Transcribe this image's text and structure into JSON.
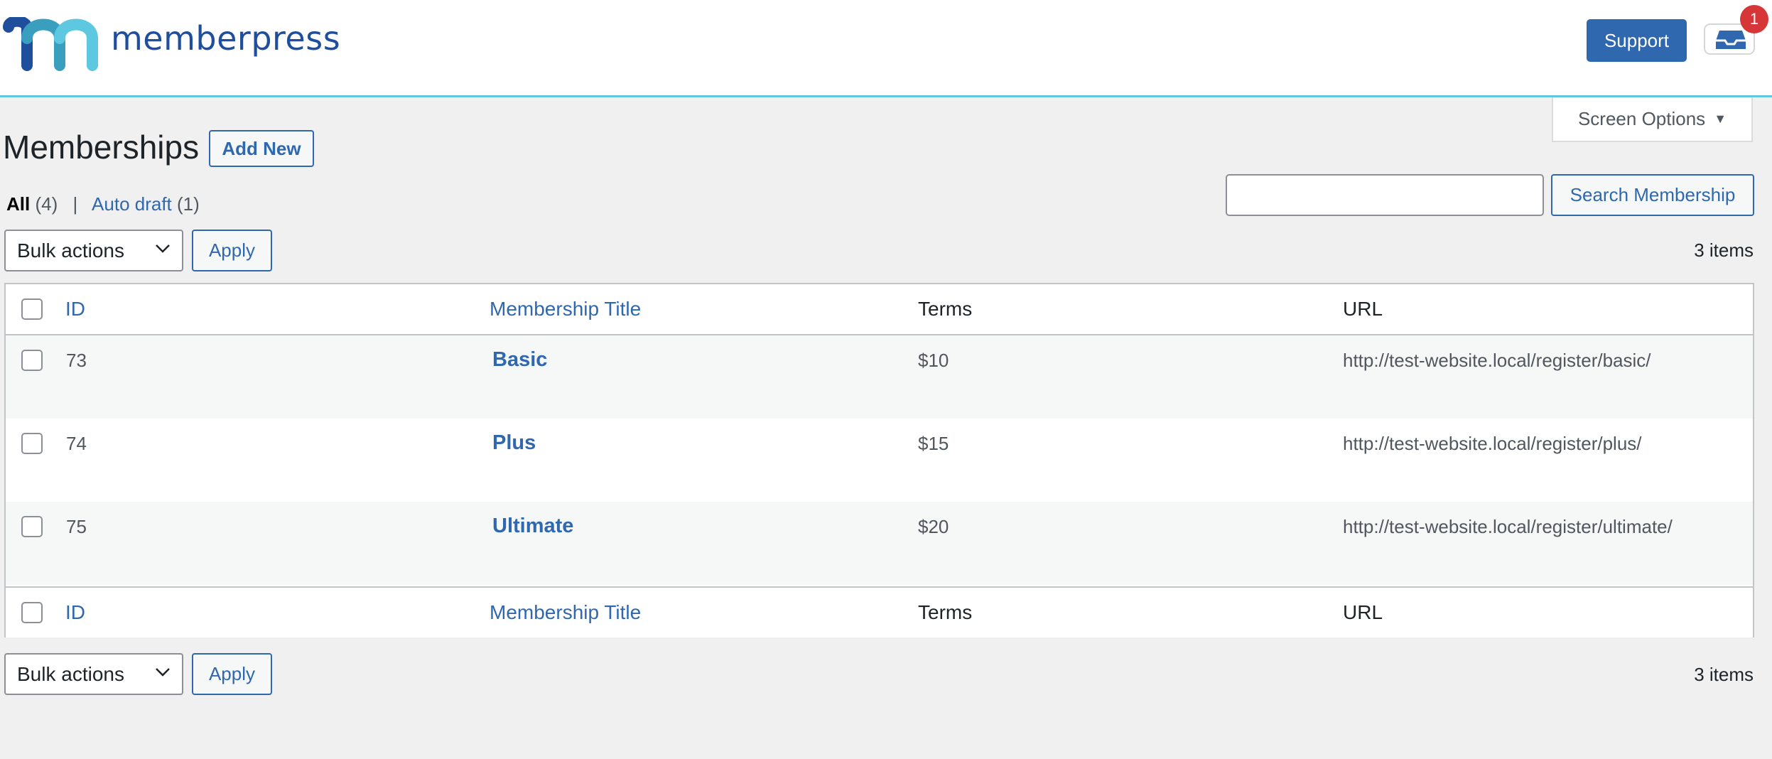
{
  "header": {
    "brand": "memberpress",
    "support_label": "Support",
    "inbox_badge": "1",
    "colors": {
      "brand": "#1f4f9c",
      "accent": "#2f68ae",
      "badge": "#d63638",
      "rule": "#5ec8e0"
    }
  },
  "screen_options": {
    "label": "Screen Options",
    "icon": "caret-down-icon"
  },
  "page": {
    "title": "Memberships",
    "add_new_label": "Add New"
  },
  "filters": {
    "all_label": "All",
    "all_count": "(4)",
    "separator": "|",
    "auto_draft_label": "Auto draft",
    "auto_draft_count": "(1)"
  },
  "search": {
    "value": "",
    "placeholder": "",
    "button_label": "Search Membership"
  },
  "tablenav_top": {
    "bulk_label": "Bulk actions",
    "apply_label": "Apply",
    "items_count": "3 items"
  },
  "tablenav_bottom": {
    "bulk_label": "Bulk actions",
    "apply_label": "Apply",
    "items_count": "3 items"
  },
  "table": {
    "columns": [
      "ID",
      "Membership Title",
      "Terms",
      "URL"
    ],
    "rows": [
      {
        "id": "73",
        "title": "Basic",
        "terms": "$10",
        "url": "http://test-website.local/register/basic/"
      },
      {
        "id": "74",
        "title": "Plus",
        "terms": "$15",
        "url": "http://test-website.local/register/plus/"
      },
      {
        "id": "75",
        "title": "Ultimate",
        "terms": "$20",
        "url": "http://test-website.local/register/ultimate/"
      }
    ]
  }
}
